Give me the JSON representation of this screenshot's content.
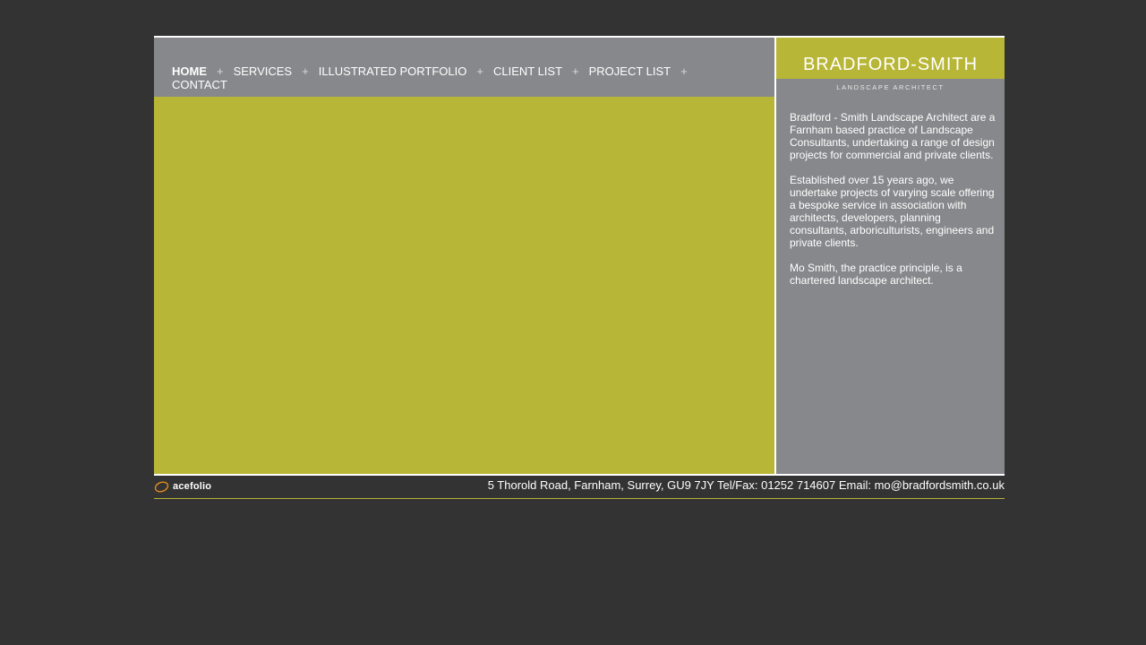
{
  "nav": {
    "items": [
      {
        "label": "HOME",
        "active": true
      },
      {
        "label": "SERVICES",
        "active": false
      },
      {
        "label": "ILLUSTRATED PORTFOLIO",
        "active": false
      },
      {
        "label": "CLIENT LIST",
        "active": false
      },
      {
        "label": "PROJECT LIST",
        "active": false
      },
      {
        "label": "CONTACT",
        "active": false
      }
    ],
    "separator": "+"
  },
  "logo": {
    "name": "BRADFORD-SMITH",
    "tagline": "LANDSCAPE ARCHITECT"
  },
  "intro": {
    "paragraphs": [
      "Bradford - Smith Landscape Architect are a Farnham based practice of Landscape Consultants, undertaking a range of design projects for commercial and private clients.",
      "Established over 15 years ago, we undertake projects of varying scale offering a bespoke service in association with architects, developers, planning consultants, arboriculturists, engineers and private clients.",
      "Mo Smith, the practice principle, is a chartered landscape architect."
    ]
  },
  "footer": {
    "credit": "acefolio",
    "address": "5 Thorold Road, Farnham, Surrey, GU9 7JY Tel/Fax: 01252 714607 Email: mo@bradfordsmith.co.uk"
  },
  "colors": {
    "background": "#333333",
    "panel_grey": "#87888b",
    "accent_olive": "#b8b636",
    "text": "#ffffff",
    "credit_orange": "#e08a1e"
  },
  "icons": {
    "credit_logo": "acefolio-swoosh-icon"
  }
}
